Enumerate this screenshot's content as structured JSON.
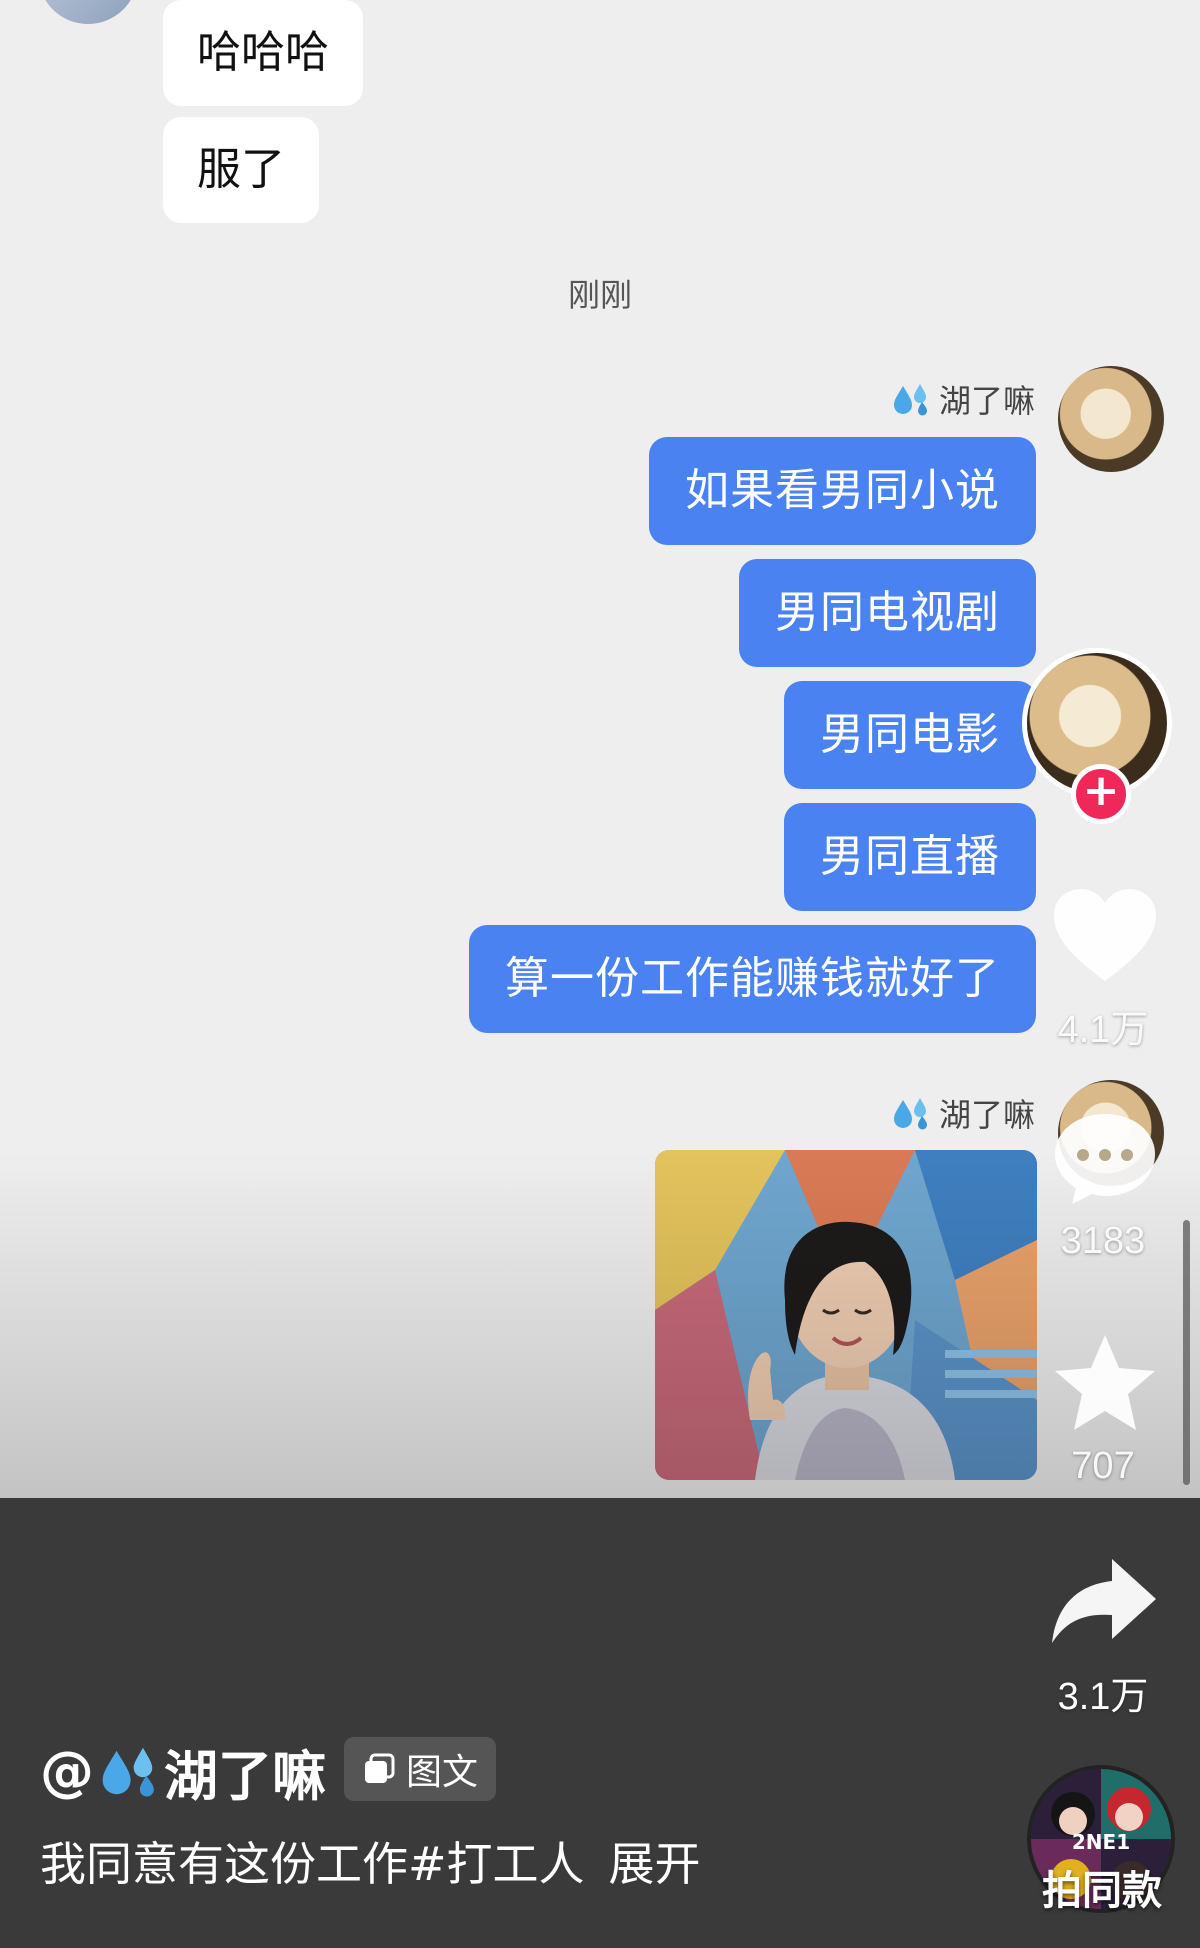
{
  "chat": {
    "incoming": [
      {
        "text": "哈哈哈"
      },
      {
        "text": "服了"
      }
    ],
    "timestamp": "刚刚",
    "sender_name": "湖了嘛",
    "outgoing": [
      {
        "text": "如果看男同小说"
      },
      {
        "text": "男同电视剧"
      },
      {
        "text": "男同电影"
      },
      {
        "text": "男同直播"
      },
      {
        "text": "算一份工作能赚钱就好了"
      }
    ],
    "sender_name_2": "湖了嘛"
  },
  "actions": {
    "likes": "4.1万",
    "comments": "3183",
    "favorites": "707",
    "shares": "3.1万",
    "follow_icon": "plus-icon"
  },
  "post": {
    "author_prefix": "@",
    "author_name": "湖了嘛",
    "type_tag": "图文",
    "caption": "我同意有这份工作#打工人",
    "expand_label": "展开"
  },
  "music": {
    "disc_text": "2NE1",
    "label": "拍同款"
  },
  "colors": {
    "chat_bg": "#eeeeee",
    "outgoing_bubble": "#4b82f1",
    "incoming_bubble": "#ffffff",
    "follow_accent": "#f0285a",
    "bottom_panel": "#3a3a3a"
  }
}
